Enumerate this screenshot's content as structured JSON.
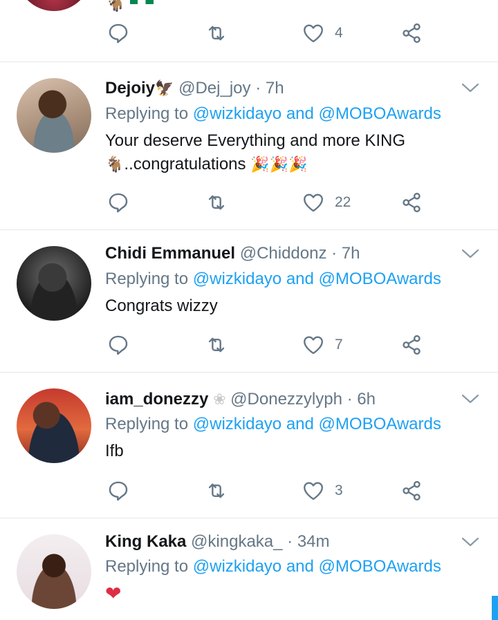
{
  "top_fragment": {
    "emoji": "🐐",
    "actions": {
      "like_count": "4"
    }
  },
  "tweets": [
    {
      "name": "Dejoiy",
      "badge": "🦅",
      "handle": "@Dej_joy",
      "time": "· 7h",
      "replying_prefix": "Replying to",
      "mention1": "@wizkidayo",
      "conj": "and",
      "mention2": "@MOBOAwards",
      "text_line1": "Your deserve Everything and more KING",
      "text_line2_emoji": "🐐",
      "text_line2": "..congratulations",
      "text_line2_trailing": "🎉🎉🎉",
      "like_count": "22"
    },
    {
      "name": "Chidi Emmanuel",
      "handle": "@Chiddonz",
      "time": "· 7h",
      "replying_prefix": "Replying to",
      "mention1": "@wizkidayo",
      "conj": "and",
      "mention2": "@MOBOAwards",
      "text_line1": "Congrats wizzy",
      "like_count": "7"
    },
    {
      "name": "iam_donezzy",
      "badge": "❀",
      "handle": "@Donezzylyph",
      "time": "· 6h",
      "replying_prefix": "Replying to",
      "mention1": "@wizkidayo",
      "conj": "and",
      "mention2": "@MOBOAwards",
      "text_line1": "Ifb",
      "like_count": "3"
    },
    {
      "name": "King Kaka",
      "handle": "@kingkaka_",
      "time": "· 34m",
      "replying_prefix": "Replying to",
      "mention1": "@wizkidayo",
      "conj": "and",
      "mention2": "@MOBOAwards",
      "text_line1": "❤"
    }
  ],
  "colors": {
    "accent": "#1da1f2",
    "muted": "#657786",
    "text": "#14171a",
    "divider": "#e1e8ed",
    "heart": "#dd2e44"
  }
}
